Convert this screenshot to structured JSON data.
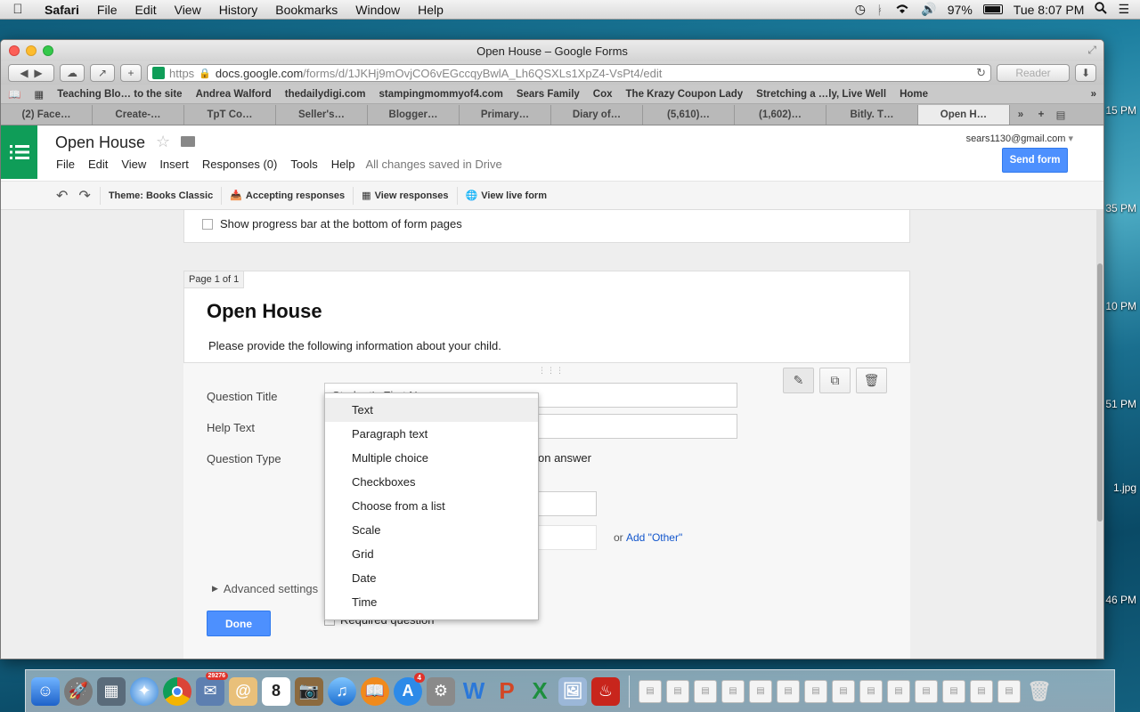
{
  "menubar": {
    "app": "Safari",
    "items": [
      "File",
      "Edit",
      "View",
      "History",
      "Bookmarks",
      "Window",
      "Help"
    ],
    "battery": "97%",
    "clock": "Tue 8:07 PM"
  },
  "desktop_labels": [
    "15 PM",
    "35 PM",
    "10 PM",
    "51 PM",
    "1.jpg",
    "46 PM"
  ],
  "window": {
    "title": "Open House – Google Forms",
    "url_scheme": "https",
    "url_host": "docs.google.com",
    "url_path": "/forms/d/1JKHj9mOvjCO6vEGccqyBwlA_Lh6QSXLs1XpZ4-VsPt4/edit",
    "reader_label": "Reader"
  },
  "bookmarks": [
    "Teaching Blo… to the site",
    "Andrea Walford",
    "thedailydigi.com",
    "stampingmommyof4.com",
    "Sears Family",
    "Cox",
    "The Krazy Coupon Lady",
    "Stretching a …ly, Live Well",
    "Home"
  ],
  "tabs": [
    "(2) Face…",
    "Create-…",
    "TpT Co…",
    "Seller's…",
    "Blogger…",
    "Primary…",
    "Diary of…",
    "(5,610)…",
    "(1,602)…",
    "Bitly. T…",
    "Open H…"
  ],
  "doc": {
    "title": "Open House",
    "menu": [
      "File",
      "Edit",
      "View",
      "Insert",
      "Responses (0)",
      "Tools",
      "Help"
    ],
    "saved_status": "All changes saved in Drive",
    "account": "sears1130@gmail.com",
    "send_label": "Send form"
  },
  "edit_toolbar": {
    "theme": "Theme: Books Classic",
    "accepting": "Accepting responses",
    "view_responses": "View responses",
    "view_live": "View live form"
  },
  "form": {
    "progress_label": "Show progress bar at the bottom of form pages",
    "page_label": "Page 1 of 1",
    "title": "Open House",
    "description": "Please provide the following information about your child.",
    "question": {
      "title_label": "Question Title",
      "title_value": "Student's First Name",
      "help_label": "Help Text",
      "type_label": "Question Type",
      "type_suffix": "on answer",
      "add_other_prefix": "or",
      "add_other_link": "Add \"Other\"",
      "advanced_label": "Advanced settings",
      "done_label": "Done",
      "required_label": "Required question"
    },
    "type_options": [
      "Text",
      "Paragraph text",
      "Multiple choice",
      "Checkboxes",
      "Choose from a list",
      "Scale",
      "Grid",
      "Date",
      "Time"
    ],
    "selected_type": "Text"
  },
  "dock": {
    "calendar_day": "8",
    "mail_badge": "29276",
    "appstore_badge": "4"
  }
}
